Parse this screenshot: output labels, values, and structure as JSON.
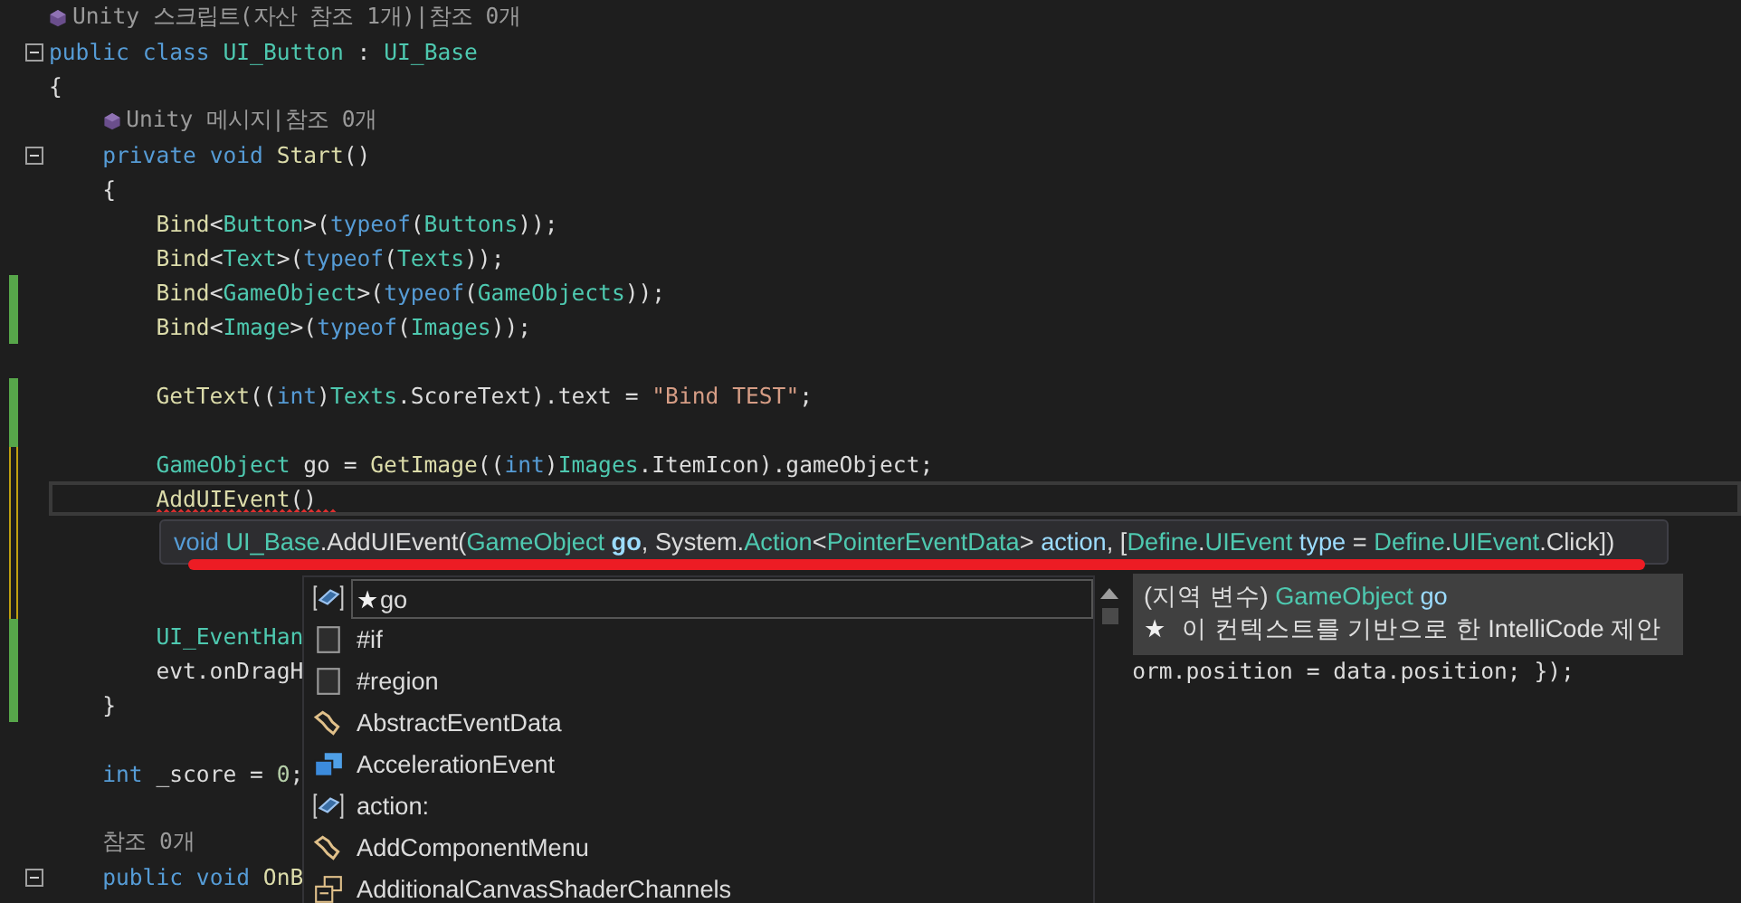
{
  "code_lines": [
    {
      "kind": "unity_lens",
      "text": "Unity 스크립트(자산 참조 1개)|참조 0개"
    },
    {
      "kind": "code",
      "expanded": true,
      "tokens": [
        {
          "kind": "kw",
          "text": "public class"
        },
        {
          "kind": "type",
          "text": " UI_Button"
        },
        {
          "kind": "p",
          "text": " : "
        },
        {
          "kind": "type",
          "text": "UI_Base"
        }
      ]
    },
    {
      "kind": "code",
      "tokens": [
        {
          "kind": "p",
          "text": "{"
        }
      ],
      "children": [
        {
          "kind": "unity_lens",
          "text": "Unity 메시지|참조 0개"
        },
        {
          "kind": "code",
          "expanded": true,
          "tokens": [
            {
              "kind": "kw",
              "text": "private void"
            },
            {
              "kind": "method",
              "text": " Start"
            },
            {
              "kind": "p",
              "text": "()"
            }
          ]
        },
        {
          "kind": "code",
          "tokens": [
            {
              "kind": "p",
              "text": "{"
            }
          ],
          "children": [
            {
              "kind": "code",
              "tokens": [
                {
                  "kind": "method",
                  "text": "Bind"
                },
                {
                  "kind": "p",
                  "text": "<"
                },
                {
                  "kind": "type",
                  "text": "Button"
                },
                {
                  "kind": "p",
                  "text": ">("
                },
                {
                  "kind": "kw",
                  "text": "typeof"
                },
                {
                  "kind": "p",
                  "text": "("
                },
                {
                  "kind": "type",
                  "text": "Buttons"
                },
                {
                  "kind": "p",
                  "text": "));"
                }
              ]
            },
            {
              "kind": "code",
              "tokens": [
                {
                  "kind": "method",
                  "text": "Bind"
                },
                {
                  "kind": "p",
                  "text": "<"
                },
                {
                  "kind": "type",
                  "text": "Text"
                },
                {
                  "kind": "p",
                  "text": ">("
                },
                {
                  "kind": "kw",
                  "text": "typeof"
                },
                {
                  "kind": "p",
                  "text": "("
                },
                {
                  "kind": "type",
                  "text": "Texts"
                },
                {
                  "kind": "p",
                  "text": "));"
                }
              ]
            },
            {
              "kind": "code",
              "modified": true,
              "saved": true,
              "tokens": [
                {
                  "kind": "method",
                  "text": "Bind"
                },
                {
                  "kind": "p",
                  "text": "<"
                },
                {
                  "kind": "type",
                  "text": "GameObject"
                },
                {
                  "kind": "p",
                  "text": ">("
                },
                {
                  "kind": "kw",
                  "text": "typeof"
                },
                {
                  "kind": "p",
                  "text": "("
                },
                {
                  "kind": "type",
                  "text": "GameObjects"
                },
                {
                  "kind": "p",
                  "text": "));"
                }
              ]
            },
            {
              "kind": "code",
              "modified": true,
              "saved": true,
              "tokens": [
                {
                  "kind": "method",
                  "text": "Bind"
                },
                {
                  "kind": "p",
                  "text": "<"
                },
                {
                  "kind": "type",
                  "text": "Image"
                },
                {
                  "kind": "p",
                  "text": ">("
                },
                {
                  "kind": "kw",
                  "text": "typeof"
                },
                {
                  "kind": "p",
                  "text": "("
                },
                {
                  "kind": "type",
                  "text": "Images"
                },
                {
                  "kind": "p",
                  "text": "));"
                }
              ]
            },
            {
              "kind": "blank"
            },
            {
              "kind": "code",
              "modified": true,
              "saved": true,
              "tokens": [
                {
                  "kind": "method",
                  "text": "GetText"
                },
                {
                  "kind": "p",
                  "text": "(("
                },
                {
                  "kind": "kw",
                  "text": "int"
                },
                {
                  "kind": "p",
                  "text": ")"
                },
                {
                  "kind": "type",
                  "text": "Texts"
                },
                {
                  "kind": "p",
                  "text": ".ScoreText).text = "
                },
                {
                  "kind": "str",
                  "text": "\"Bind TEST\""
                },
                {
                  "kind": "p",
                  "text": ";"
                }
              ]
            },
            {
              "kind": "blank",
              "modified": true,
              "saved": true
            },
            {
              "kind": "code",
              "modified": true,
              "saved": false,
              "tokens": [
                {
                  "kind": "type",
                  "text": "GameObject"
                },
                {
                  "kind": "p",
                  "text": " go = "
                },
                {
                  "kind": "method",
                  "text": "GetImage"
                },
                {
                  "kind": "p",
                  "text": "(("
                },
                {
                  "kind": "kw",
                  "text": "int"
                },
                {
                  "kind": "p",
                  "text": ")"
                },
                {
                  "kind": "type",
                  "text": "Images"
                },
                {
                  "kind": "p",
                  "text": ".ItemIcon).gameObject;"
                }
              ]
            },
            {
              "kind": "code",
              "modified": true,
              "saved": false,
              "current": true,
              "error": true,
              "tokens": [
                {
                  "kind": "method",
                  "text": "AddUIEvent"
                },
                {
                  "kind": "p",
                  "text": "()"
                }
              ]
            },
            {
              "kind": "blank",
              "modified": true,
              "saved": false
            },
            {
              "kind": "blank",
              "modified": true,
              "saved": false
            },
            {
              "kind": "blank",
              "modified": true,
              "saved": false
            },
            {
              "kind": "code",
              "modified": true,
              "saved": true,
              "tokens": [
                {
                  "kind": "type",
                  "text": "UI_EventHan"
                }
              ]
            },
            {
              "kind": "code",
              "modified": true,
              "saved": true,
              "tokens": [
                {
                  "kind": "p",
                  "text": "evt.onDragH"
                }
              ],
              "tail": "orm.position = data.position; });"
            }
          ]
        },
        {
          "kind": "code",
          "modified": true,
          "saved": true,
          "tokens": [
            {
              "kind": "p",
              "text": "}"
            }
          ]
        },
        {
          "kind": "blank"
        },
        {
          "kind": "code",
          "tokens": [
            {
              "kind": "kw",
              "text": "int"
            },
            {
              "kind": "p",
              "text": " _score = "
            },
            {
              "kind": "num",
              "text": "0"
            },
            {
              "kind": "p",
              "text": ";"
            }
          ]
        },
        {
          "kind": "blank"
        },
        {
          "kind": "lens",
          "text": "참조 0개"
        },
        {
          "kind": "code",
          "expanded": true,
          "tokens": [
            {
              "kind": "kw",
              "text": "public void"
            },
            {
              "kind": "method",
              "text": " OnB"
            }
          ]
        }
      ]
    }
  ],
  "signature_tooltip": [
    {
      "kind": "kw",
      "text": "void"
    },
    {
      "kind": "type",
      "text": " UI_Base"
    },
    {
      "kind": "p",
      "text": ".AddUIEvent("
    },
    {
      "kind": "type",
      "text": "GameObject"
    },
    {
      "kind": "cur",
      "text": " go"
    },
    {
      "kind": "p",
      "text": ", System."
    },
    {
      "kind": "type",
      "text": "Action"
    },
    {
      "kind": "p",
      "text": "<"
    },
    {
      "kind": "type",
      "text": "PointerEventData"
    },
    {
      "kind": "p",
      "text": "> "
    },
    {
      "kind": "param",
      "text": "action"
    },
    {
      "kind": "p",
      "text": ", ["
    },
    {
      "kind": "type",
      "text": "Define"
    },
    {
      "kind": "p",
      "text": "."
    },
    {
      "kind": "type",
      "text": "UIEvent"
    },
    {
      "kind": "param",
      "text": " type"
    },
    {
      "kind": "p",
      "text": " = "
    },
    {
      "kind": "type",
      "text": "Define"
    },
    {
      "kind": "p",
      "text": "."
    },
    {
      "kind": "type",
      "text": "UIEvent"
    },
    {
      "kind": "p",
      "text": ".Click])"
    }
  ],
  "completion_list": [
    {
      "label": "go",
      "star": "★",
      "kind": "variable",
      "selected": true
    },
    {
      "label": "#if",
      "kind": "snippet",
      "selected": false
    },
    {
      "label": "#region",
      "kind": "snippet",
      "selected": false
    },
    {
      "label": "AbstractEventData",
      "kind": "class",
      "selected": false
    },
    {
      "label": "AccelerationEvent",
      "kind": "struct",
      "selected": false
    },
    {
      "label": "action:",
      "kind": "variable",
      "selected": false
    },
    {
      "label": "AddComponentMenu",
      "kind": "class",
      "selected": false
    },
    {
      "label": "AdditionalCanvasShaderChannels",
      "kind": "enum",
      "selected": false
    }
  ],
  "description": {
    "line1": [
      {
        "kind": "p",
        "text": "(지역 변수) "
      },
      {
        "kind": "type",
        "text": "GameObject"
      },
      {
        "kind": "param",
        "text": " go"
      }
    ],
    "star": "★",
    "line2": "이 컨텍스트를 기반으로 한 IntelliCode 제안"
  }
}
